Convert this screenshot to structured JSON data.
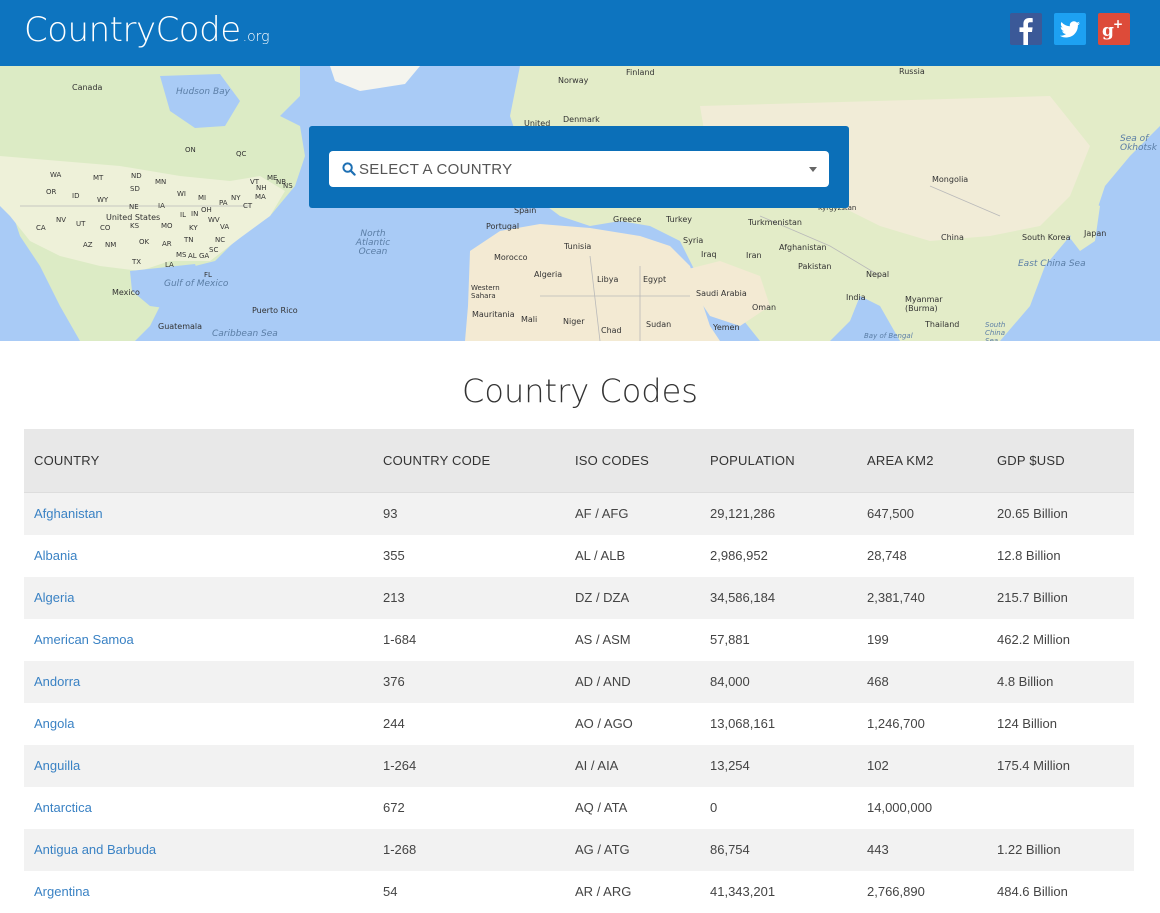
{
  "header": {
    "logo_main": "CountryCode",
    "logo_tld": ".org",
    "social": [
      {
        "name": "facebook",
        "icon": "facebook-icon",
        "color": "#3b5998"
      },
      {
        "name": "twitter",
        "icon": "twitter-icon",
        "color": "#1da1f2"
      },
      {
        "name": "google-plus",
        "icon": "google-plus-icon",
        "color": "#dd4b39"
      }
    ],
    "color": "#0d74bf"
  },
  "map": {
    "labels": [
      "Canada",
      "Hudson Bay",
      "United States",
      "Mexico",
      "Gulf of Mexico",
      "Puerto Rico",
      "Guatemala",
      "Caribbean Sea",
      "North Atlantic Ocean",
      "Norway",
      "Finland",
      "Russia",
      "Denmark",
      "United",
      "Spain",
      "Portugal",
      "Greece",
      "Turkey",
      "Tunisia",
      "Morocco",
      "Algeria",
      "Libya",
      "Egypt",
      "Syria",
      "Iraq",
      "Iran",
      "Turkmenistan",
      "Afghanistan",
      "Pakistan",
      "India",
      "Nepal",
      "China",
      "Mongolia",
      "South Korea",
      "Japan",
      "Sea of Okhotsk",
      "East China Sea",
      "Saudi Arabia",
      "Yemen",
      "Oman",
      "Sudan",
      "Chad",
      "Niger",
      "Mali",
      "Mauritania",
      "Western Sahara",
      "Myanmar (Burma)",
      "Thailand",
      "Bay of Bengal",
      "South China Sea",
      "Kyrgyzstan"
    ],
    "us_states": [
      "WA",
      "MT",
      "ND",
      "MN",
      "WI",
      "MI",
      "OR",
      "ID",
      "WY",
      "SD",
      "IA",
      "NE",
      "IL",
      "IN",
      "OH",
      "PA",
      "NY",
      "VT",
      "ME",
      "NH",
      "MA",
      "CT",
      "NV",
      "UT",
      "CO",
      "KS",
      "MO",
      "KY",
      "WV",
      "VA",
      "CA",
      "AZ",
      "NM",
      "OK",
      "AR",
      "TN",
      "NC",
      "SC",
      "TX",
      "LA",
      "MS",
      "AL",
      "GA",
      "FL",
      "ON",
      "QC",
      "NB",
      "NS"
    ]
  },
  "search": {
    "placeholder": "SELECT A COUNTRY",
    "icon": "search-icon"
  },
  "main": {
    "title": "Country Codes"
  },
  "table": {
    "columns": [
      "COUNTRY",
      "COUNTRY CODE",
      "ISO CODES",
      "POPULATION",
      "AREA KM2",
      "GDP $USD"
    ],
    "rows": [
      [
        "Afghanistan",
        "93",
        "AF / AFG",
        "29,121,286",
        "647,500",
        "20.65 Billion"
      ],
      [
        "Albania",
        "355",
        "AL / ALB",
        "2,986,952",
        "28,748",
        "12.8 Billion"
      ],
      [
        "Algeria",
        "213",
        "DZ / DZA",
        "34,586,184",
        "2,381,740",
        "215.7 Billion"
      ],
      [
        "American Samoa",
        "1-684",
        "AS / ASM",
        "57,881",
        "199",
        "462.2 Million"
      ],
      [
        "Andorra",
        "376",
        "AD / AND",
        "84,000",
        "468",
        "4.8 Billion"
      ],
      [
        "Angola",
        "244",
        "AO / AGO",
        "13,068,161",
        "1,246,700",
        "124 Billion"
      ],
      [
        "Anguilla",
        "1-264",
        "AI / AIA",
        "13,254",
        "102",
        "175.4 Million"
      ],
      [
        "Antarctica",
        "672",
        "AQ / ATA",
        "0",
        "14,000,000",
        ""
      ],
      [
        "Antigua and Barbuda",
        "1-268",
        "AG / ATG",
        "86,754",
        "443",
        "1.22 Billion"
      ],
      [
        "Argentina",
        "54",
        "AR / ARG",
        "41,343,201",
        "2,766,890",
        "484.6 Billion"
      ]
    ]
  }
}
